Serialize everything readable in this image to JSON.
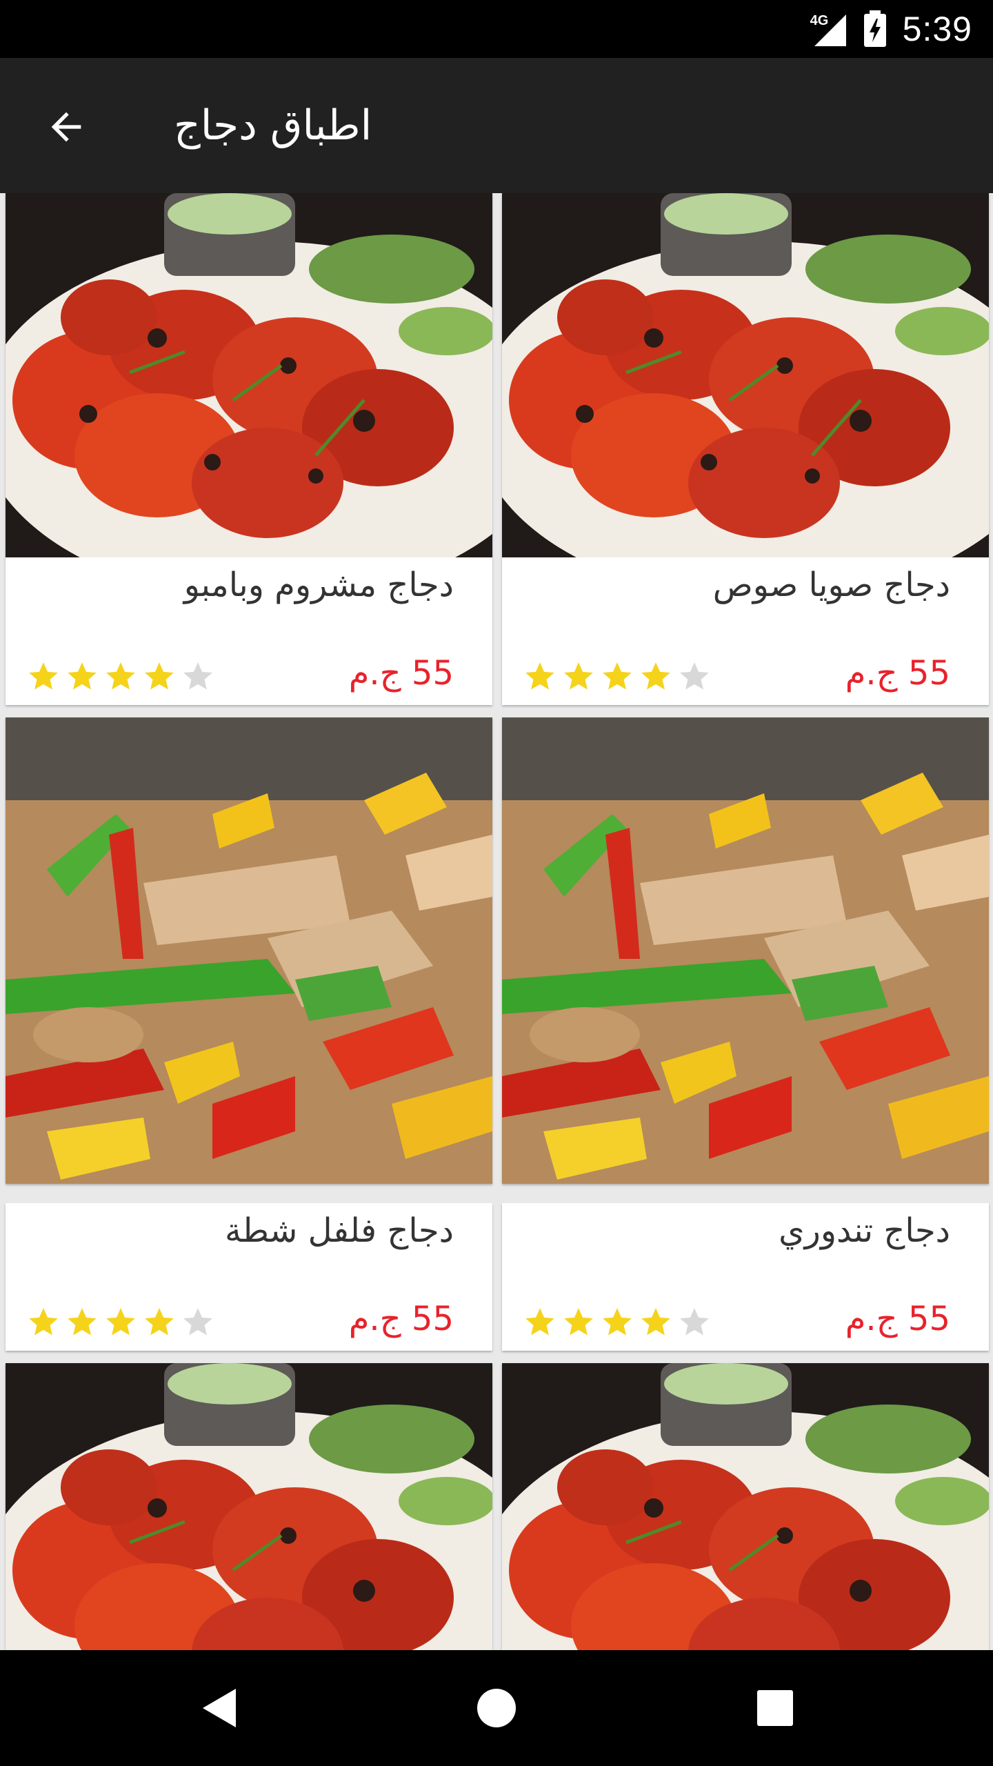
{
  "status_bar": {
    "time": "5:39",
    "network": "4G"
  },
  "app_bar": {
    "title": "اطباق دجاج",
    "back_icon": "arrow-back-icon"
  },
  "colors": {
    "app_bar": "#212121",
    "price": "#e8222b",
    "star_filled": "#f5d31b",
    "star_empty": "#d8d8d8"
  },
  "cards": [
    {
      "name": "دجاج صويا صوص",
      "price": "55 ج.م",
      "rating": 4,
      "rating_max": 5,
      "image": "tandoori-chicken-photo"
    },
    {
      "name": "دجاج مشروم وبامبو",
      "price": "55 ج.م",
      "rating": 4,
      "rating_max": 5,
      "image": "tandoori-chicken-photo"
    },
    {
      "name": "دجاج تندوري",
      "price": "55 ج.م",
      "rating": 4,
      "rating_max": 5,
      "image": "chicken-peppers-photo"
    },
    {
      "name": "دجاج فلفل شطة",
      "price": "55 ج.م",
      "rating": 4,
      "rating_max": 5,
      "image": "chicken-peppers-photo"
    },
    {
      "name": "",
      "price": "",
      "rating": 0,
      "rating_max": 5,
      "image": "tandoori-chicken-photo"
    },
    {
      "name": "",
      "price": "",
      "rating": 0,
      "rating_max": 5,
      "image": "tandoori-chicken-photo"
    }
  ],
  "nav_bar": {
    "back_icon": "nav-back-icon",
    "home_icon": "nav-home-icon",
    "recents_icon": "nav-recents-icon"
  }
}
